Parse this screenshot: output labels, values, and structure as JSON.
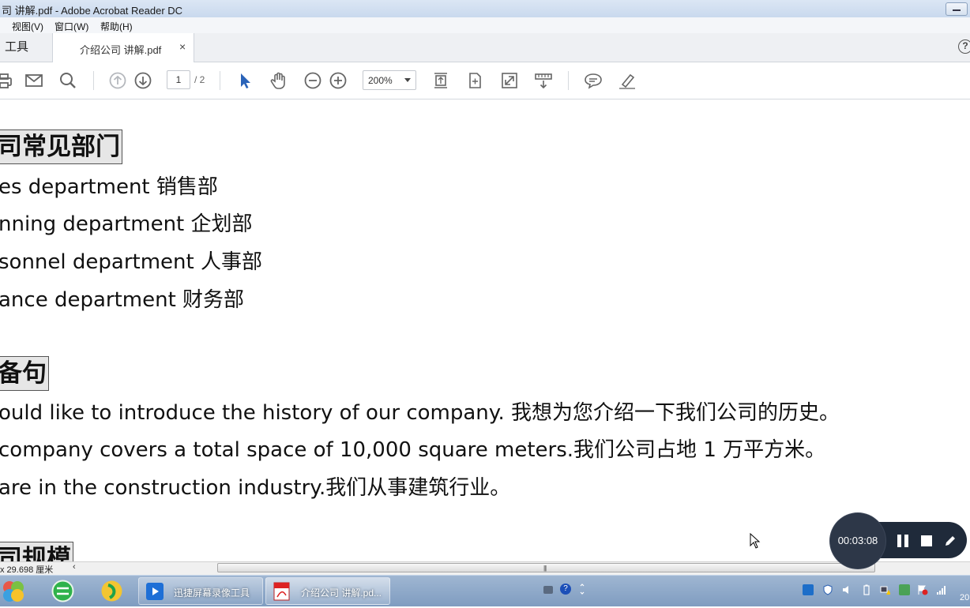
{
  "window": {
    "title": "司 讲解.pdf - Adobe Acrobat Reader DC"
  },
  "menu": {
    "items": [
      {
        "label": ""
      },
      {
        "label": "视图(V)"
      },
      {
        "label": "窗口(W)"
      },
      {
        "label": "帮助(H)"
      }
    ]
  },
  "tabs": {
    "tools": "工具",
    "document": "介绍公司 讲解.pdf",
    "close": "×",
    "help": "?"
  },
  "toolbar": {
    "current_page": "1",
    "total_pages": "/ 2",
    "zoom": "200%",
    "icons": [
      "print-icon",
      "email-icon",
      "search-icon",
      "prev-page-icon",
      "next-page-icon",
      "select-cursor-icon",
      "hand-icon",
      "zoom-out-icon",
      "zoom-in-icon",
      "fit-page-icon",
      "rotate-icon",
      "fullscreen-icon",
      "scroll-mode-icon",
      "comment-icon",
      "highlight-pen-icon"
    ]
  },
  "document": {
    "heading1": "司常见部门",
    "departments": [
      "es department 销售部",
      "nning department 企划部",
      "sonnel department 人事部",
      "ance department 财务部"
    ],
    "heading2": "备句",
    "sentences": [
      "ould like to introduce the history of our company.  我想为您介绍一下我们公司的历史。",
      " company covers a total space of 10,000 square meters.我们公司占地 1 万平方米。",
      "are in the construction industry.我们从事建筑行业。"
    ],
    "heading3": "司规模"
  },
  "status": {
    "page_size": "x 29.698 厘米",
    "scroll_left": "‹",
    "grip": "|||"
  },
  "recorder": {
    "timer": "00:03:08"
  },
  "taskbar": {
    "apps": [
      {
        "label": "迅捷屏幕录像工具"
      },
      {
        "label": "介绍公司 讲解.pd..."
      }
    ],
    "clock": "20"
  }
}
